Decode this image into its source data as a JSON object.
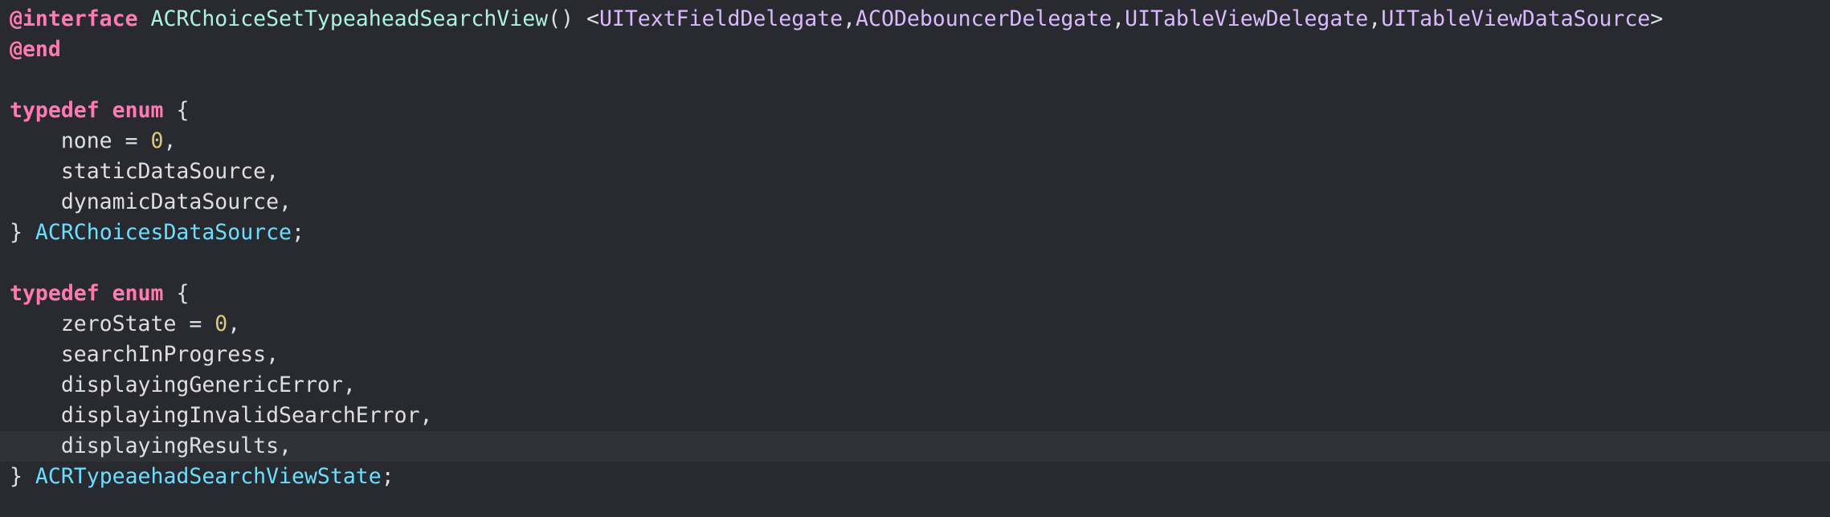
{
  "editor": {
    "lines": [
      {
        "tokens": [
          {
            "cls": "kw",
            "text": "@interface"
          },
          {
            "cls": "plain",
            "text": " "
          },
          {
            "cls": "cls",
            "text": "ACRChoiceSetTypeaheadSearchView"
          },
          {
            "cls": "plain",
            "text": "() <"
          },
          {
            "cls": "type",
            "text": "UITextFieldDelegate"
          },
          {
            "cls": "plain",
            "text": ","
          },
          {
            "cls": "type",
            "text": "ACODebouncerDelegate"
          },
          {
            "cls": "plain",
            "text": ","
          },
          {
            "cls": "type",
            "text": "UITableViewDelegate"
          },
          {
            "cls": "plain",
            "text": ","
          },
          {
            "cls": "type",
            "text": "UITableViewDataSource"
          },
          {
            "cls": "plain",
            "text": ">"
          }
        ]
      },
      {
        "tokens": [
          {
            "cls": "kw",
            "text": "@end"
          }
        ]
      },
      {
        "tokens": []
      },
      {
        "tokens": [
          {
            "cls": "kw",
            "text": "typedef"
          },
          {
            "cls": "plain",
            "text": " "
          },
          {
            "cls": "kw",
            "text": "enum"
          },
          {
            "cls": "plain",
            "text": " {"
          }
        ]
      },
      {
        "tokens": [
          {
            "cls": "plain",
            "text": "    none = "
          },
          {
            "cls": "num",
            "text": "0"
          },
          {
            "cls": "plain",
            "text": ","
          }
        ]
      },
      {
        "tokens": [
          {
            "cls": "plain",
            "text": "    staticDataSource,"
          }
        ]
      },
      {
        "tokens": [
          {
            "cls": "plain",
            "text": "    dynamicDataSource,"
          }
        ]
      },
      {
        "tokens": [
          {
            "cls": "plain",
            "text": "} "
          },
          {
            "cls": "usertype",
            "text": "ACRChoicesDataSource"
          },
          {
            "cls": "plain",
            "text": ";"
          }
        ]
      },
      {
        "tokens": []
      },
      {
        "tokens": [
          {
            "cls": "kw",
            "text": "typedef"
          },
          {
            "cls": "plain",
            "text": " "
          },
          {
            "cls": "kw",
            "text": "enum"
          },
          {
            "cls": "plain",
            "text": " {"
          }
        ]
      },
      {
        "tokens": [
          {
            "cls": "plain",
            "text": "    zeroState = "
          },
          {
            "cls": "num",
            "text": "0"
          },
          {
            "cls": "plain",
            "text": ","
          }
        ]
      },
      {
        "tokens": [
          {
            "cls": "plain",
            "text": "    searchInProgress,"
          }
        ]
      },
      {
        "tokens": [
          {
            "cls": "plain",
            "text": "    displayingGenericError,"
          }
        ]
      },
      {
        "tokens": [
          {
            "cls": "plain",
            "text": "    displayingInvalidSearchError,"
          }
        ]
      },
      {
        "tokens": [
          {
            "cls": "plain",
            "text": "    displayingResults,"
          }
        ],
        "current": true
      },
      {
        "tokens": [
          {
            "cls": "plain",
            "text": "} "
          },
          {
            "cls": "usertype",
            "text": "ACRTypeaehadSearchViewState"
          },
          {
            "cls": "plain",
            "text": ";"
          }
        ]
      }
    ]
  },
  "colors": {
    "background": "#292a30",
    "current_line": "#2f3239",
    "keyword": "#ff7ab2",
    "protocol": "#dabaff",
    "class": "#acf2e4",
    "user_type": "#6bdfff",
    "number": "#d9c97c",
    "plain": "#dfdfe0"
  }
}
